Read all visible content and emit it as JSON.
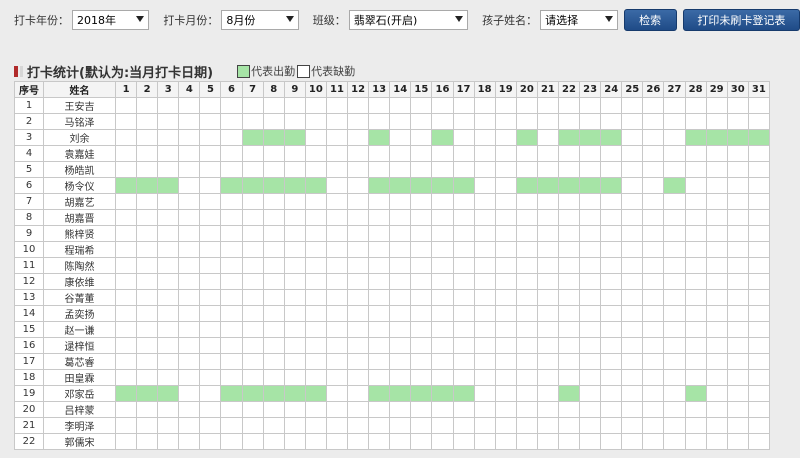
{
  "filters": {
    "year_label": "打卡年份：",
    "year_value": "2018年",
    "month_label": "打卡月份：",
    "month_value": "8月份",
    "class_label": "班级：",
    "class_value": "翡翠石(开启)",
    "child_label": "孩子姓名：",
    "child_value": "请选择"
  },
  "buttons": {
    "search": "检索",
    "print": "打印未刷卡登记表"
  },
  "section": {
    "title": "打卡统计(默认为:当月打卡日期)",
    "legend_present": "代表出勤",
    "legend_absent": "代表缺勤"
  },
  "table": {
    "col_index": "序号",
    "col_name": "姓名",
    "days": [
      "1",
      "2",
      "3",
      "4",
      "5",
      "6",
      "7",
      "8",
      "9",
      "10",
      "11",
      "12",
      "13",
      "14",
      "15",
      "16",
      "17",
      "18",
      "19",
      "20",
      "21",
      "22",
      "23",
      "24",
      "25",
      "26",
      "27",
      "28",
      "29",
      "30",
      "31"
    ],
    "rows": [
      {
        "no": "1",
        "name": "王安吉",
        "present": []
      },
      {
        "no": "2",
        "name": "马铭泽",
        "present": []
      },
      {
        "no": "3",
        "name": "刘余",
        "present": [
          7,
          8,
          9,
          13,
          16,
          20,
          22,
          23,
          24,
          28,
          29,
          30,
          31
        ]
      },
      {
        "no": "4",
        "name": "袁嘉娃",
        "present": []
      },
      {
        "no": "5",
        "name": "杨皓凯",
        "present": []
      },
      {
        "no": "6",
        "name": "杨令仪",
        "present": [
          1,
          2,
          3,
          6,
          7,
          8,
          9,
          10,
          13,
          14,
          15,
          16,
          17,
          20,
          21,
          22,
          23,
          24,
          27
        ]
      },
      {
        "no": "7",
        "name": "胡嘉艺",
        "present": []
      },
      {
        "no": "8",
        "name": "胡嘉晋",
        "present": []
      },
      {
        "no": "9",
        "name": "熊梓贤",
        "present": []
      },
      {
        "no": "10",
        "name": "程瑞希",
        "present": []
      },
      {
        "no": "11",
        "name": "陈陶然",
        "present": []
      },
      {
        "no": "12",
        "name": "康依维",
        "present": []
      },
      {
        "no": "13",
        "name": "谷菁董",
        "present": []
      },
      {
        "no": "14",
        "name": "孟奕扬",
        "present": []
      },
      {
        "no": "15",
        "name": "赵一谦",
        "present": []
      },
      {
        "no": "16",
        "name": "逯梓恒",
        "present": []
      },
      {
        "no": "17",
        "name": "葛芯睿",
        "present": []
      },
      {
        "no": "18",
        "name": "田皇霖",
        "present": []
      },
      {
        "no": "19",
        "name": "邓家岳",
        "present": [
          1,
          2,
          3,
          6,
          7,
          8,
          9,
          10,
          13,
          14,
          15,
          16,
          17,
          22,
          28
        ]
      },
      {
        "no": "20",
        "name": "吕梓蒙",
        "present": []
      },
      {
        "no": "21",
        "name": "李明泽",
        "present": []
      },
      {
        "no": "22",
        "name": "郭儒宋",
        "present": []
      }
    ]
  },
  "colors": {
    "present": "#a6e4a6",
    "button": "#2a5896"
  }
}
